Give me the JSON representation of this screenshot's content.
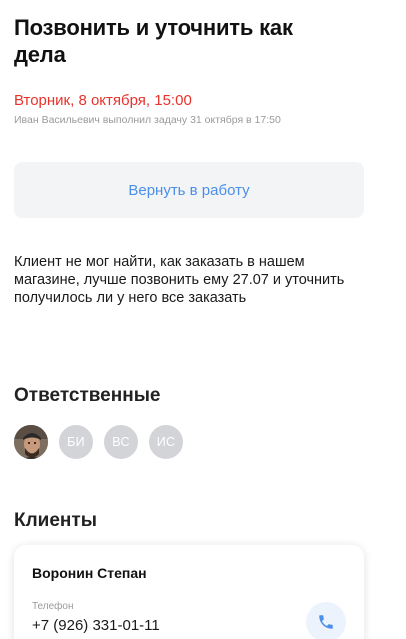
{
  "task": {
    "title": "Позвонить и уточнить как дела",
    "due_date": "Вторник, 8 октября, 15:00",
    "completion_note": "Иван Васильевич выполнил задачу 31 октября в 17:50",
    "return_button_label": "Вернуть в работу",
    "description": "Клиент не мог найти, как заказать в нашем магазине, лучше позвонить ему 27.07 и уточнить получилось ли у него все заказать"
  },
  "responsible": {
    "title": "Ответственные",
    "avatars": [
      {
        "type": "photo",
        "icon": "user-photo-avatar"
      },
      {
        "type": "initials",
        "initials": "БИ"
      },
      {
        "type": "initials",
        "initials": "ВС"
      },
      {
        "type": "initials",
        "initials": "ИС"
      }
    ]
  },
  "clients": {
    "title": "Клиенты",
    "items": [
      {
        "name": "Воронин Степан",
        "phone_label": "Телефон",
        "phone": "+7 (926) 331-01-11",
        "call_icon": "phone-icon"
      }
    ]
  },
  "colors": {
    "due_date": "#e8322b",
    "accent": "#4b8fe8",
    "button_bg": "#f3f4f6",
    "avatar_bg": "#d3d4d8",
    "muted_text": "#9a9a9a"
  }
}
